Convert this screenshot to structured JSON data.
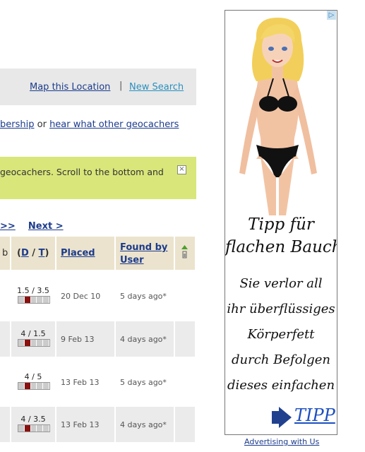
{
  "toolbar": {
    "map_link": "Map this Location",
    "separator": "|",
    "new_search": "New Search"
  },
  "info": {
    "link1": "bership",
    "mid": " or ",
    "link2": "hear what other geocachers"
  },
  "notice": {
    "text": "geocachers. Scroll to the bottom and",
    "close": "×"
  },
  "pager": {
    "prev": ">>",
    "next": "Next >"
  },
  "table": {
    "headers": {
      "col_b": "b",
      "dt_open": "(",
      "d": "D",
      "dt_slash": " / ",
      "t": "T",
      "dt_close": ")",
      "placed": "Placed",
      "found": "Found by User"
    },
    "rows": [
      {
        "dt": "1.5 / 3.5",
        "placed": "20 Dec 10",
        "found": "5 days ago*",
        "alt": false
      },
      {
        "dt": "4 / 1.5",
        "placed": "9 Feb 13",
        "found": "4 days ago*",
        "alt": true
      },
      {
        "dt": "4 / 5",
        "placed": "13 Feb 13",
        "found": "5 days ago*",
        "alt": false
      },
      {
        "dt": "4 / 3.5",
        "placed": "13 Feb 13",
        "found": "4 days ago*",
        "alt": true
      }
    ]
  },
  "ad": {
    "headline1": "Tipp für",
    "headline2": "flachen Bauch",
    "lines": [
      "Sie verlor all",
      "ihr überflüssiges",
      "Körperfett",
      "durch Befolgen",
      "dieses einfachen"
    ],
    "cta": "TIPP",
    "choice": "▷",
    "footer": "Advertising with Us"
  }
}
